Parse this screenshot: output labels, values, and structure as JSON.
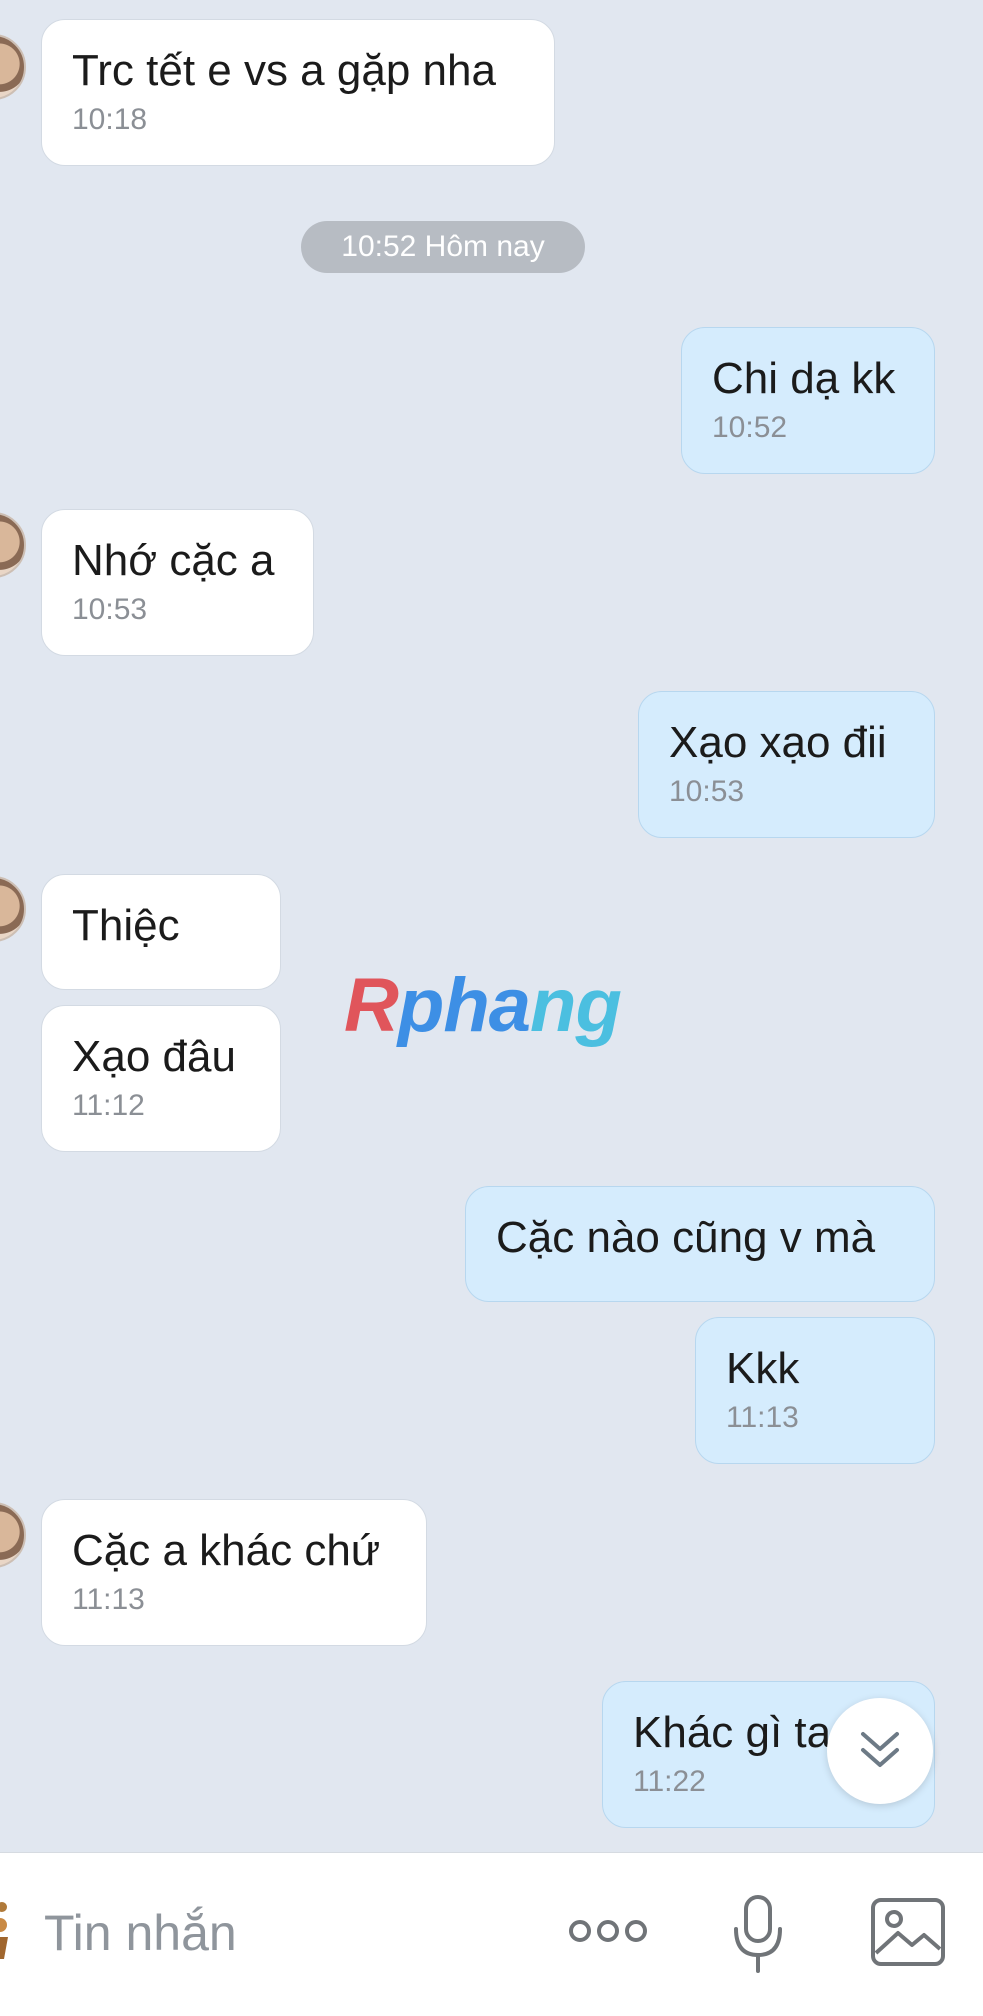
{
  "date_separator": "10:52 Hôm nay",
  "messages": [
    {
      "text": "Trc tết e vs a gặp nha",
      "time": "10:18"
    },
    {
      "text": "Chi dạ kk",
      "time": "10:52"
    },
    {
      "text": "Nhớ cặc a",
      "time": "10:53"
    },
    {
      "text": "Xạo xạo đii",
      "time": "10:53"
    },
    {
      "text": "Thiệc",
      "time": ""
    },
    {
      "text": "Xạo đâu",
      "time": "11:12"
    },
    {
      "text": "Cặc nào cũng v mà",
      "time": ""
    },
    {
      "text": "Kkk",
      "time": "11:13"
    },
    {
      "text": "Cặc a khác chứ",
      "time": "11:13"
    },
    {
      "text": "Khác gì ta",
      "time": "11:22"
    }
  ],
  "watermark": {
    "part1": "R",
    "part2": "pha",
    "part3": "ng"
  },
  "composer": {
    "placeholder": "Tin nhắn"
  },
  "icons": {
    "sticker": "sticker-icon",
    "more": "more-options-icon",
    "mic": "microphone-icon",
    "image": "image-icon",
    "scroll": "chevron-double-down-icon"
  },
  "colors": {
    "background": "#e1e7f0",
    "incoming_bubble": "#ffffff",
    "outgoing_bubble": "#d5ecfd",
    "timestamp": "#8b8f95"
  }
}
